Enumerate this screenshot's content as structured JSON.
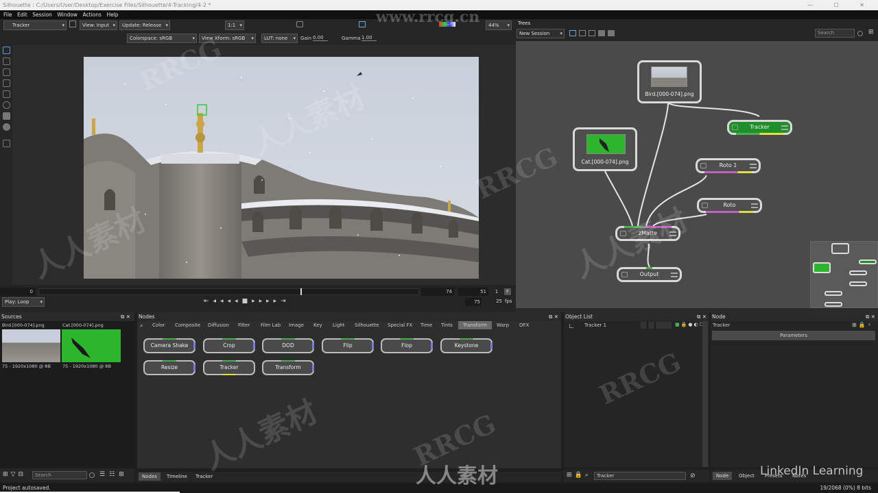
{
  "window": {
    "title": "Silhouette : C:/Users/User/Desktop/Exercise Files/Silhouette/4-Tracking/4-2 *"
  },
  "menu": [
    "File",
    "Edit",
    "Session",
    "Window",
    "Actions",
    "Help"
  ],
  "toolbar": {
    "tool_select": "Tracker",
    "view": "View: Input",
    "update": "Update: Release",
    "ratio": "1:1",
    "zoom": "44%"
  },
  "toolbar2": {
    "colorspace": "Colorspace: sRGB",
    "view_xform": "View Xform: sRGB",
    "lut": "LUT: none",
    "gain_label": "Gain",
    "gain_value": "0.00",
    "gamma_label": "Gamma",
    "gamma_value": "1.00"
  },
  "timeline": {
    "start": "0",
    "current": "74",
    "end_frame": "51",
    "step": "1",
    "f_flag": "F",
    "play_mode": "Play: Loop",
    "end": "75",
    "fps_value": "25",
    "fps_label": "fps"
  },
  "trees": {
    "title": "Trees",
    "session": "New Session",
    "search_placeholder": "Search",
    "nodes": {
      "bird": "Bird.[000-074].png",
      "cat": "Cat.[000-074].png",
      "tracker": "Tracker",
      "roto1": "Roto 1",
      "roto": "Roto",
      "zmatte": "zMatte",
      "output": "Output"
    }
  },
  "sources": {
    "title": "Sources",
    "items": [
      {
        "name": "Bird.[000-074].png",
        "info": "75 - 1920x1080 @ 8B"
      },
      {
        "name": "Cat.[000-074].png",
        "info": "75 - 1920x1080 @ 8B"
      }
    ],
    "search_placeholder": "Search"
  },
  "nodes_panel": {
    "title": "Nodes",
    "categories": [
      "Color",
      "Composite",
      "Diffusion",
      "Filter",
      "Film Lab",
      "Image",
      "Key",
      "Light",
      "Silhouette",
      "Special FX",
      "Time",
      "Tints",
      "Transform",
      "Warp",
      "OFX"
    ],
    "active_category": "Transform",
    "buttons": [
      "Camera Shake",
      "Crop",
      "DOD",
      "Flip",
      "Flop",
      "Keystone",
      "Resize",
      "Tracker",
      "Transform"
    ],
    "bottom_tabs": [
      "Nodes",
      "Timeline",
      "Tracker"
    ]
  },
  "object_list": {
    "title": "Object List",
    "item": "Tracker 1",
    "footer_field": "Tracker"
  },
  "node_panel": {
    "title": "Node",
    "name": "Tracker",
    "params_label": "Parameters",
    "bottom_tabs": [
      "Node",
      "Object",
      "Presets",
      "Notes"
    ]
  },
  "status": {
    "message": "Project autosaved.",
    "memory": "19/2068 (0%) 8 bits"
  },
  "watermarks": {
    "brand": "LinkedIn Learning",
    "site": "www.rrcg.cn",
    "rrcg": "RRCG",
    "cn": "人人素材"
  },
  "colors": {
    "accent_green": "#1f8f2a",
    "node_border": "#d9d9d9",
    "tab_active": "#6a6a6a"
  }
}
